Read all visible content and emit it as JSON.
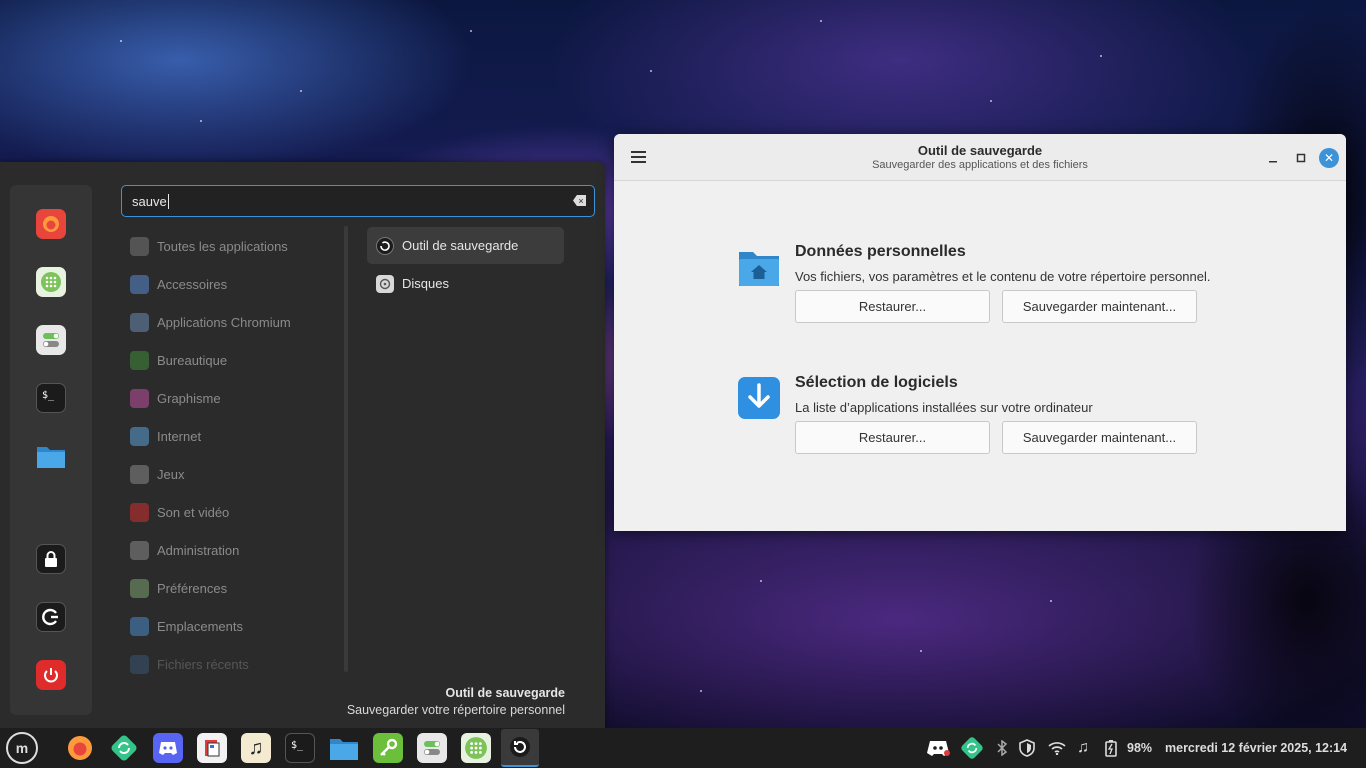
{
  "menu": {
    "search_value": "sauve",
    "categories": [
      {
        "label": "Toutes les applications",
        "color": "#777777"
      },
      {
        "label": "Accessoires",
        "color": "#5a8ad0"
      },
      {
        "label": "Applications Chromium",
        "color": "#6a8bb0"
      },
      {
        "label": "Bureautique",
        "color": "#3f8a3a"
      },
      {
        "label": "Graphisme",
        "color": "#c04fa0"
      },
      {
        "label": "Internet",
        "color": "#5aa0d8"
      },
      {
        "label": "Jeux",
        "color": "#888888"
      },
      {
        "label": "Son et vidéo",
        "color": "#d03030"
      },
      {
        "label": "Administration",
        "color": "#888888"
      },
      {
        "label": "Préférences",
        "color": "#7aa070"
      },
      {
        "label": "Emplacements",
        "color": "#4a8ac8"
      },
      {
        "label": "Fichiers récents",
        "color": "#4a8ac8"
      }
    ],
    "results": [
      {
        "label": "Outil de sauvegarde",
        "icon": "backup-icon"
      },
      {
        "label": "Disques",
        "icon": "disks-icon"
      }
    ],
    "description": {
      "title": "Outil de sauvegarde",
      "subtitle": "Sauvegarder votre répertoire personnel"
    },
    "favorites": [
      "firefox-icon",
      "calculator-icon",
      "settings-toggle-icon",
      "terminal-icon",
      "files-folder-icon"
    ],
    "session": [
      "lock-icon",
      "logout-icon",
      "power-icon"
    ]
  },
  "window": {
    "title": "Outil de sauvegarde",
    "subtitle": "Sauvegarder des applications et des fichiers",
    "sections": [
      {
        "title": "Données personnelles",
        "subtitle": "Vos fichiers, vos paramètres et le contenu de votre répertoire personnel.",
        "restore": "Restaurer...",
        "backup": "Sauvegarder maintenant..."
      },
      {
        "title": "Sélection de logiciels",
        "subtitle": "La liste d’applications installées sur votre ordinateur",
        "restore": "Restaurer...",
        "backup": "Sauvegarder maintenant..."
      }
    ]
  },
  "panel": {
    "battery": "98%",
    "clock": "mercredi 12 février 2025, 12:14",
    "apps": [
      "mint-menu-icon",
      "firefox-icon",
      "update-manager-icon",
      "discord-icon",
      "news-icon",
      "music-icon",
      "terminal-icon",
      "files-folder-icon",
      "key-icon",
      "settings-toggle-icon",
      "calculator-icon",
      "backup-icon"
    ],
    "tray": [
      "discord-icon",
      "update-manager-icon",
      "bluetooth-icon",
      "shield-icon",
      "wifi-icon",
      "music-note-icon",
      "battery-icon"
    ]
  },
  "colors": {
    "accent": "#3d93d8",
    "menu_bg": "#2b2b2b",
    "window_bg": "#f0f0f0"
  }
}
